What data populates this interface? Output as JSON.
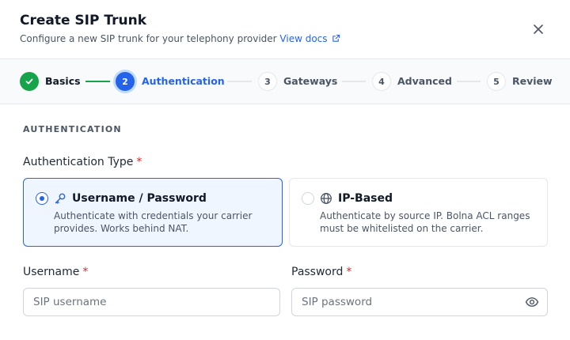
{
  "dialog": {
    "title": "Create SIP Trunk",
    "subtitle": "Configure a new SIP trunk for your telephony provider",
    "docs_link": "View docs"
  },
  "stepper": {
    "steps": [
      {
        "number": "",
        "label": "Basics",
        "status": "completed"
      },
      {
        "number": "2",
        "label": "Authentication",
        "status": "active"
      },
      {
        "number": "3",
        "label": "Gateways",
        "status": "upcoming"
      },
      {
        "number": "4",
        "label": "Advanced",
        "status": "upcoming"
      },
      {
        "number": "5",
        "label": "Review",
        "status": "upcoming"
      }
    ]
  },
  "section": {
    "heading": "AUTHENTICATION",
    "auth_type_label": "Authentication Type",
    "required_marker": "*",
    "options": [
      {
        "title": "Username / Password",
        "description": "Authenticate with credentials your carrier provides. Works behind NAT.",
        "icon": "key-icon",
        "selected": true
      },
      {
        "title": "IP-Based",
        "description": "Authenticate by source IP. Bolna ACL ranges must be whitelisted on the carrier.",
        "icon": "globe-icon",
        "selected": false
      }
    ]
  },
  "fields": {
    "username": {
      "label": "Username",
      "placeholder": "SIP username",
      "value": ""
    },
    "password": {
      "label": "Password",
      "placeholder": "SIP password",
      "value": ""
    }
  },
  "colors": {
    "accent": "#2563eb",
    "success": "#16a34a",
    "required": "#dc2626"
  }
}
